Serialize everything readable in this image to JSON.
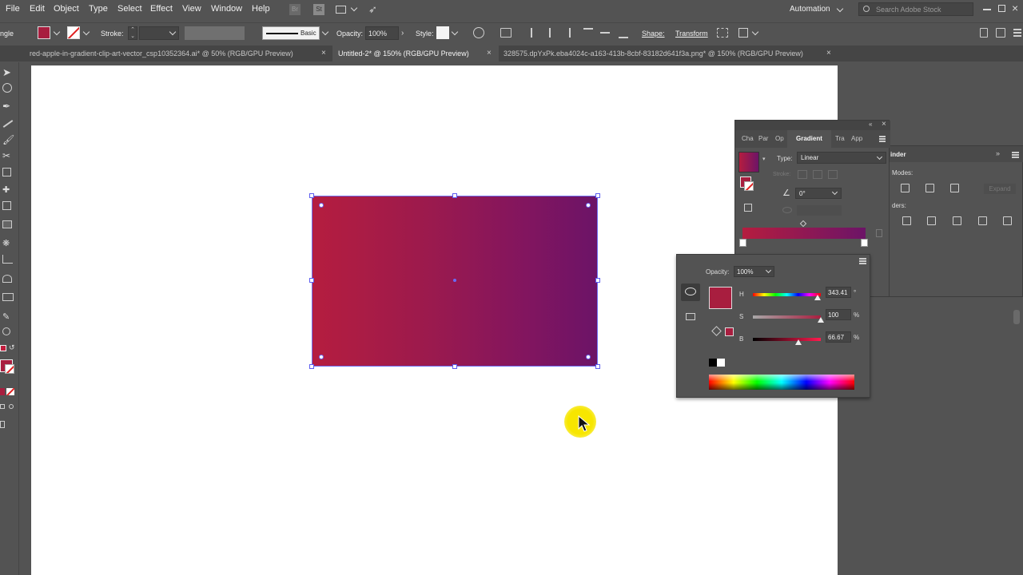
{
  "menubar": {
    "items": [
      "File",
      "Edit",
      "Object",
      "Type",
      "Select",
      "Effect",
      "View",
      "Window",
      "Help"
    ],
    "br_label": "Br",
    "st_label": "St",
    "workspace": "Automation",
    "search_placeholder": "Search Adobe Stock"
  },
  "controlbar": {
    "tool_name": "ngle",
    "stroke_label": "Stroke:",
    "brush_label": "Basic",
    "opacity_label": "Opacity:",
    "opacity_value": "100%",
    "style_label": "Style:",
    "shape_label": "Shape:",
    "transform_label": "Transform"
  },
  "tabs": [
    {
      "title": "red-apple-in-gradient-clip-art-vector_csp10352364.ai* @ 50% (RGB/GPU Preview)",
      "active": false
    },
    {
      "title": "Untitled-2* @ 150% (RGB/GPU Preview)",
      "active": true
    },
    {
      "title": "328575.dpYxPk.eba4024c-a163-413b-8cbf-83182d641f3a.png* @ 150% (RGB/GPU Preview)",
      "active": false
    }
  ],
  "gradient_panel": {
    "tabs": [
      "Cha",
      "Par",
      "Op",
      "Gradient",
      "Tra",
      "App"
    ],
    "type_label": "Type:",
    "type_value": "Linear",
    "stroke_label": "Stroke:",
    "angle_value": "0°"
  },
  "pathfinder_panel": {
    "title": "inder",
    "modes_label": "Modes:",
    "finders_label": "ders:",
    "expand_label": "Expand"
  },
  "color_panel": {
    "opacity_label": "Opacity:",
    "opacity_value": "100%",
    "h_label": "H",
    "h_value": "343.41",
    "h_unit": "°",
    "s_label": "S",
    "s_value": "100",
    "s_unit": "%",
    "b_label": "B",
    "b_value": "66.67",
    "b_unit": "%",
    "h_level": 0.95,
    "s_level": 1.0,
    "b_level": 0.67
  },
  "colors": {
    "fill": "#a81e3f",
    "gradient_start": "#b51d3f",
    "gradient_end": "#6c1467",
    "selection": "#6e6ef2",
    "cursor_highlight": "#f7e600"
  }
}
